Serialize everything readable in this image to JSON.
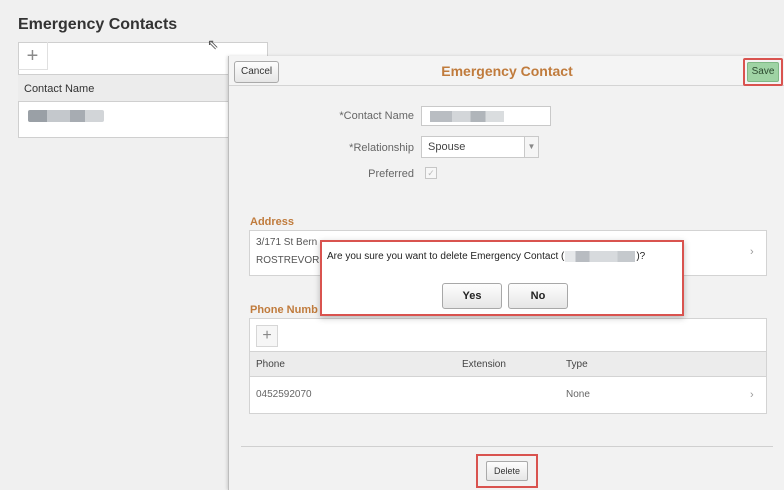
{
  "background": {
    "title": "Emergency Contacts",
    "add_glyph": "+",
    "column_header": "Contact Name"
  },
  "panel": {
    "cancel_label": "Cancel",
    "title": "Emergency Contact",
    "save_label": "Save",
    "contact_name_label": "*Contact Name",
    "relationship_label": "*Relationship",
    "relationship_value": "Spouse",
    "preferred_label": "Preferred",
    "address_title": "Address",
    "address_line1": "3/171 St Bern",
    "address_line2": "ROSTREVOR",
    "phone_title": "Phone Numb",
    "phone_add_glyph": "+",
    "phone_columns": [
      "Phone",
      "Extension",
      "Type"
    ],
    "phone_rows": [
      {
        "phone": "0452592070",
        "extension": "",
        "type": "None"
      }
    ],
    "delete_label": "Delete"
  },
  "dialog": {
    "message_before": "Are you sure you want to delete Emergency Contact (",
    "message_after": ")?",
    "yes_label": "Yes",
    "no_label": "No"
  },
  "icons": {
    "chevron": "›",
    "check": "✓",
    "dropdown": "▼",
    "cursor": "⇖"
  },
  "colors": {
    "accent_orange": "#c07b3c",
    "highlight_red": "#d9534f",
    "save_green": "#9fd3a4"
  }
}
